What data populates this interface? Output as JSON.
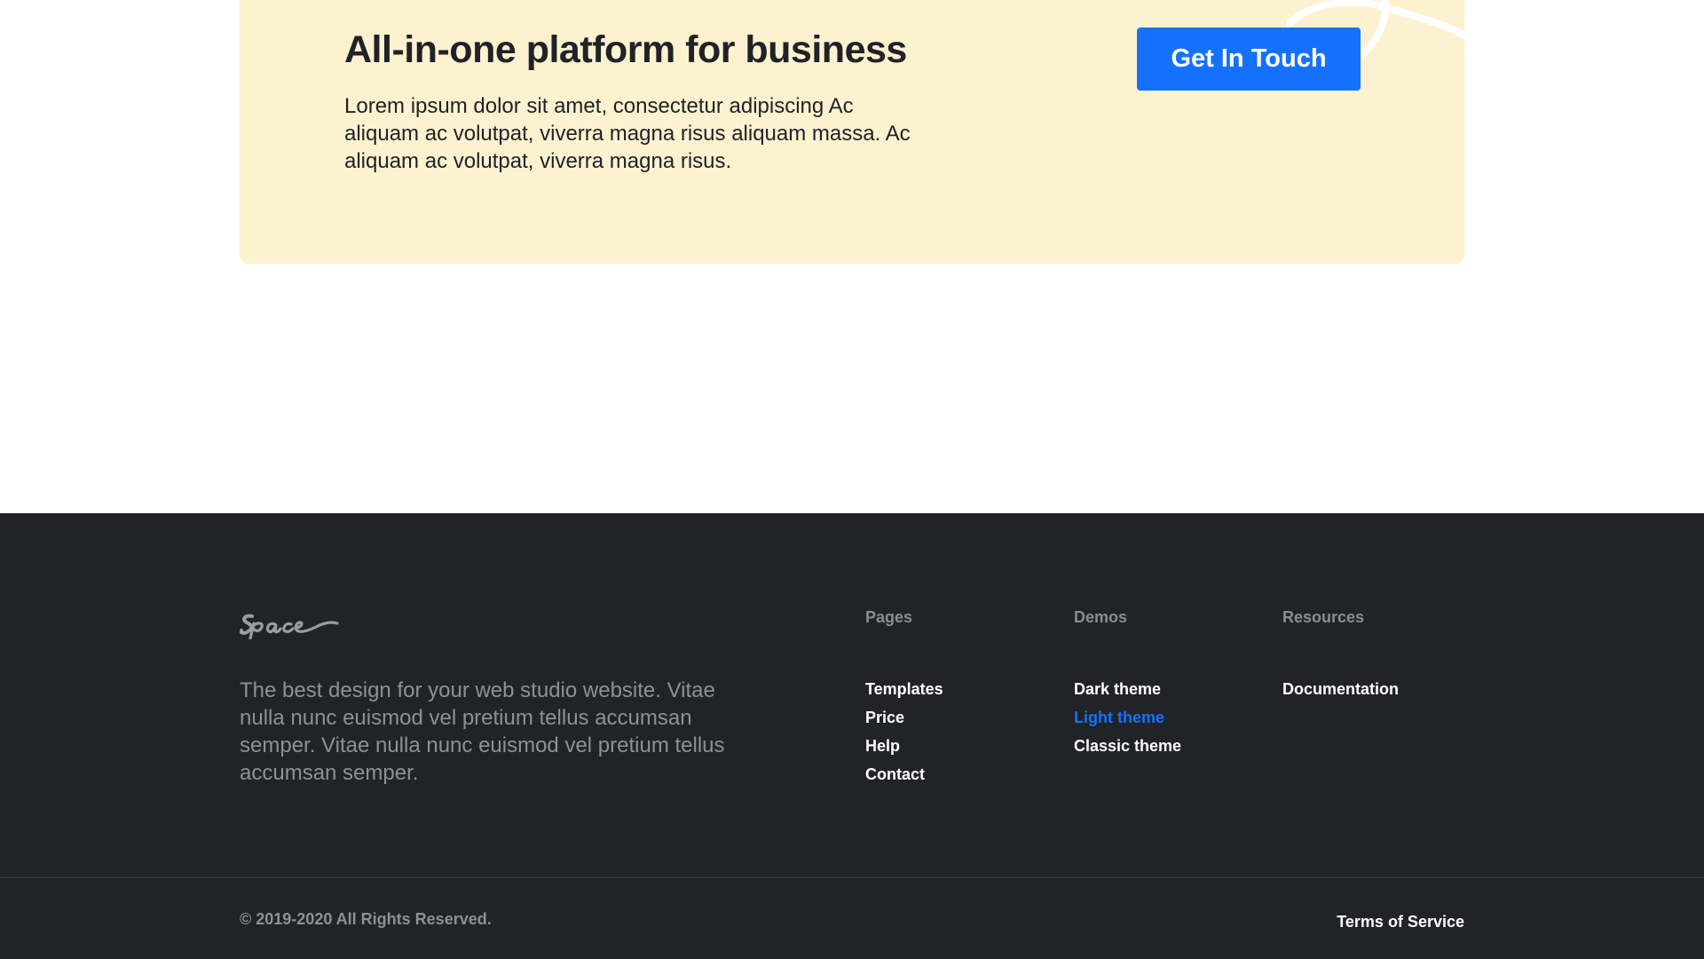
{
  "cta": {
    "title": "All-in-one platform for business",
    "text": "Lorem ipsum dolor sit amet, consectetur adipiscing Ac aliquam ac volutpat, viverra magna risus aliquam massa. Ac aliquam ac volutpat, viverra magna risus.",
    "button_label": "Get In Touch"
  },
  "footer": {
    "logo_text": "Space",
    "description": "The best design for your web studio website. Vitae nulla nunc euismod vel pretium tellus accumsan semper. Vitae nulla nunc euismod vel pretium tellus accumsan semper.",
    "columns": [
      {
        "heading": "Pages",
        "links": [
          "Templates",
          "Price",
          "Help",
          "Contact"
        ]
      },
      {
        "heading": "Demos",
        "links": [
          "Dark theme",
          "Light theme",
          "Classic theme"
        ]
      },
      {
        "heading": "Resources",
        "links": [
          "Documentation"
        ]
      }
    ],
    "copyright": "© 2019-2020 All Rights Reserved.",
    "terms_label": "Terms of Service"
  },
  "colors": {
    "accent": "#1671fa",
    "banner_bg": "#fdf2d0",
    "footer_bg": "#222328",
    "active_link": "#1671fa"
  }
}
